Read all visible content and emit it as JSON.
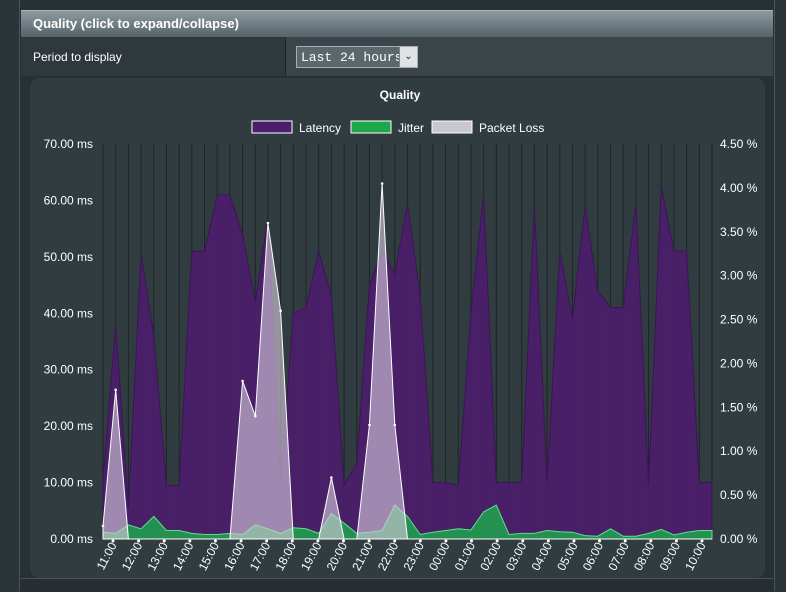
{
  "section": {
    "title": "Quality (click to expand/collapse)"
  },
  "period": {
    "label": "Period to display",
    "selected": "Last 24 hours"
  },
  "chart_data": {
    "type": "area",
    "title": "Quality",
    "legend_position": "top",
    "grid": true,
    "x_ticks": [
      "11:00",
      "12:00",
      "13:00",
      "14:00",
      "15:00",
      "16:00",
      "17:00",
      "18:00",
      "19:00",
      "20:00",
      "21:00",
      "22:00",
      "23:00",
      "00:00",
      "01:00",
      "02:00",
      "03:00",
      "04:00",
      "05:00",
      "06:00",
      "07:00",
      "08:00",
      "09:00",
      "10:00"
    ],
    "y_left": {
      "ticks": [
        "0.00 ms",
        "10.00 ms",
        "20.00 ms",
        "30.00 ms",
        "40.00 ms",
        "50.00 ms",
        "60.00 ms",
        "70.00 ms"
      ],
      "range": [
        0,
        70
      ]
    },
    "y_right": {
      "ticks": [
        "0.00 %",
        "0.50 %",
        "1.00 %",
        "1.50 %",
        "2.00 %",
        "2.50 %",
        "3.00 %",
        "3.50 %",
        "4.00 %",
        "4.50 %"
      ],
      "range": [
        0,
        4.5
      ]
    },
    "n_points": 49,
    "series": [
      {
        "name": "Latency",
        "axis": "left",
        "color": "#4b1d6b",
        "values": [
          10.5,
          38,
          5.5,
          50.5,
          36,
          9.5,
          9.5,
          51,
          51,
          61,
          61,
          54,
          42,
          57,
          10,
          40,
          41,
          51,
          43,
          9.5,
          13.5,
          45,
          51,
          47,
          59.5,
          43,
          10,
          10,
          9.5,
          40,
          61,
          10,
          10,
          10,
          59,
          10,
          51,
          39,
          59,
          44,
          41,
          41,
          59.5,
          9.5,
          62.5,
          51,
          51,
          10,
          10
        ]
      },
      {
        "name": "Jitter",
        "axis": "left",
        "color": "#1ea64c",
        "values": [
          1.2,
          1.0,
          2.5,
          1.8,
          4.0,
          1.5,
          1.5,
          1.0,
          0.8,
          0.8,
          1.0,
          0.8,
          2.5,
          1.8,
          1.0,
          2.0,
          1.8,
          1.0,
          4.5,
          2.8,
          1.0,
          1.2,
          1.5,
          6.0,
          4.0,
          0.8,
          1.2,
          1.5,
          1.8,
          1.6,
          4.8,
          6.0,
          0.8,
          1.0,
          1.0,
          1.5,
          1.3,
          1.2,
          0.6,
          0.5,
          1.8,
          0.5,
          0.5,
          1.0,
          1.7,
          0.7,
          1.2,
          1.5,
          1.5
        ]
      },
      {
        "name": "Packet Loss",
        "axis": "right",
        "color": "#c8c8cc",
        "values": [
          0.15,
          1.7,
          0,
          0,
          0,
          0,
          0,
          0,
          0,
          0,
          0,
          1.8,
          1.4,
          3.6,
          2.6,
          0,
          0,
          0,
          0.7,
          0,
          0,
          1.3,
          4.05,
          1.3,
          0,
          0,
          0,
          0,
          0,
          0,
          0,
          0,
          0,
          0,
          0,
          0,
          0,
          0,
          0,
          0,
          0,
          0,
          0,
          0,
          0,
          0,
          0,
          0,
          0
        ]
      }
    ]
  }
}
